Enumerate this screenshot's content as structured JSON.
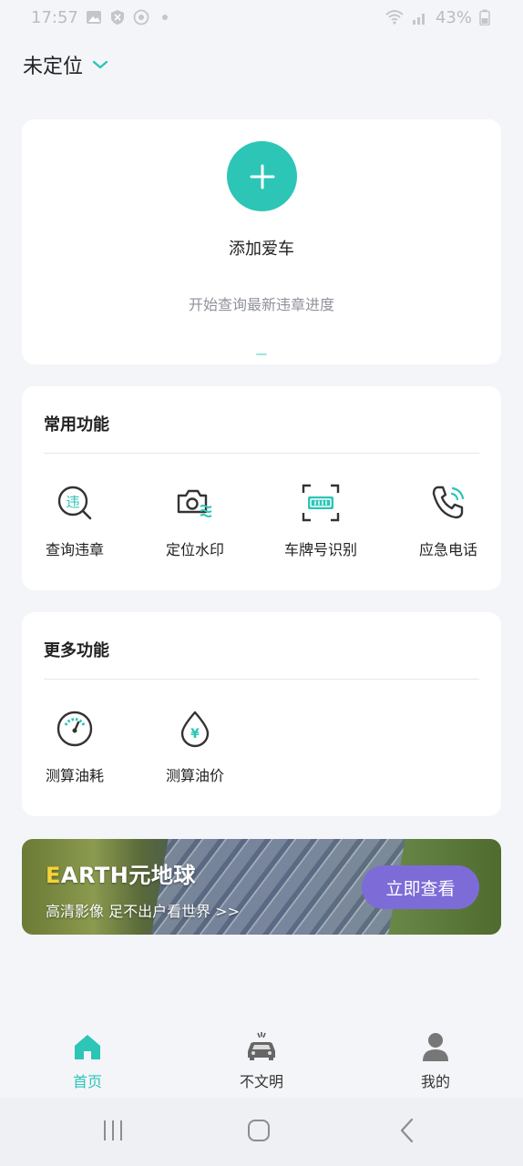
{
  "status_bar": {
    "time": "17:57",
    "battery": "43%"
  },
  "location": {
    "label": "未定位"
  },
  "add_car": {
    "title": "添加爱车",
    "subtitle": "开始查询最新违章进度"
  },
  "common_features": {
    "title": "常用功能",
    "items": [
      {
        "label": "查询违章",
        "icon": "violation-search-icon",
        "badge": "违"
      },
      {
        "label": "定位水印",
        "icon": "camera-watermark-icon"
      },
      {
        "label": "车牌号识别",
        "icon": "plate-scan-icon"
      },
      {
        "label": "应急电话",
        "icon": "phone-icon"
      }
    ]
  },
  "more_features": {
    "title": "更多功能",
    "items": [
      {
        "label": "测算油耗",
        "icon": "gauge-icon"
      },
      {
        "label": "测算油价",
        "icon": "oil-drop-icon",
        "badge": "¥"
      }
    ]
  },
  "banner": {
    "title_first": "E",
    "title_rest": "ARTH元地球",
    "subtitle": "高清影像 足不出户看世界 >>",
    "button": "立即查看"
  },
  "tabs": [
    {
      "label": "首页",
      "icon": "home-icon",
      "active": true
    },
    {
      "label": "不文明",
      "icon": "car-crash-icon",
      "active": false
    },
    {
      "label": "我的",
      "icon": "user-icon",
      "active": false
    }
  ],
  "colors": {
    "accent": "#2cc5b6",
    "banner_button": "#7d6cd8",
    "background": "#f4f5f9"
  }
}
